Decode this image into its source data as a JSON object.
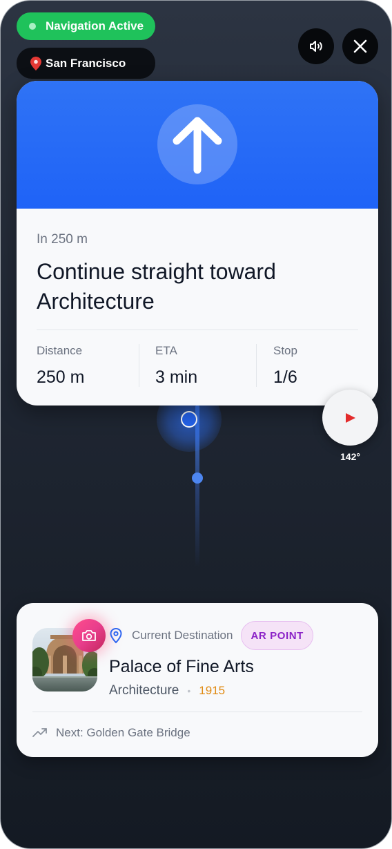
{
  "status": {
    "navigation_label": "Navigation Active",
    "city": "San Francisco"
  },
  "controls": {
    "sound_icon": "speaker-icon",
    "close_icon": "close-icon"
  },
  "instruction": {
    "direction_icon": "arrow-up-icon",
    "distance_prefix": "In 250 m",
    "text": "Continue straight toward Architecture",
    "stats": [
      {
        "label": "Distance",
        "value": "250 m"
      },
      {
        "label": "ETA",
        "value": "3 min"
      },
      {
        "label": "Stop",
        "value": "1/6"
      }
    ]
  },
  "compass": {
    "heading": "142°"
  },
  "destination": {
    "label": "Current Destination",
    "badge": "AR POINT",
    "name": "Palace of Fine Arts",
    "category": "Architecture",
    "year": "1915",
    "next": "Next: Golden Gate Bridge"
  },
  "colors": {
    "accent_blue": "#1f63f7",
    "active_green": "#1fc25b",
    "ar_purple": "#8b22c7",
    "year_orange": "#e08a12",
    "camera_pink": "#e83e8c"
  }
}
